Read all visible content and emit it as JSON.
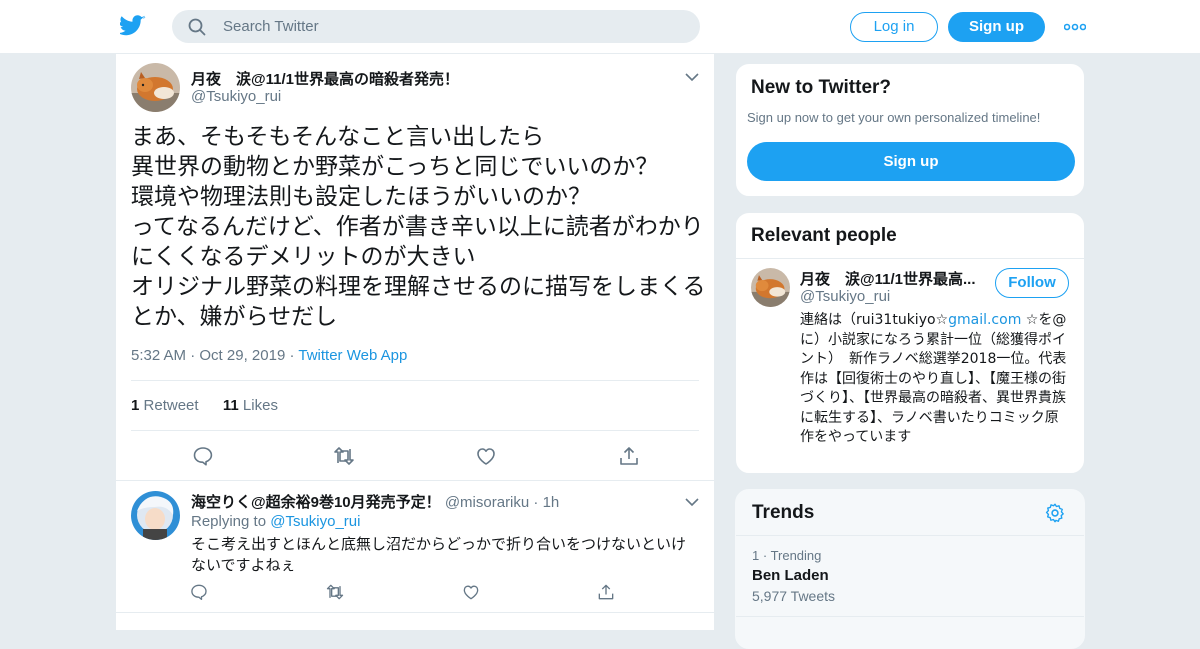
{
  "header": {
    "search_placeholder": "Search Twitter",
    "login_label": "Log in",
    "signup_label": "Sign up"
  },
  "tweet": {
    "author_name": "月夜　涙@11/1世界最高の暗殺者発売！",
    "author_handle": "@Tsukiyo_rui",
    "text": "まあ、そもそもそんなこと言い出したら\n異世界の動物とか野菜がこっちと同じでいいのか？\n環境や物理法則も設定したほうがいいのか？\nってなるんだけど、作者が書き辛い以上に読者がわかりにくくなるデメリットのが大きい\nオリジナル野菜の料理を理解させるのに描写をしまくるとか、嫌がらせだし",
    "time": "5:32 AM",
    "date": "Oct 29, 2019",
    "source": "Twitter Web App",
    "retweet_count": "1",
    "retweet_label": "Retweet",
    "like_count": "11",
    "like_label": "Likes"
  },
  "reply": {
    "author_name": "海空りく@超余裕9巻10月発売予定！",
    "author_handle": "@misorariku",
    "age": "1h",
    "replying_label": "Replying to",
    "replying_to": "@Tsukiyo_rui",
    "text": "そこ考え出すとほんと底無し沼だからどっかで折り合いをつけないといけないですよねぇ"
  },
  "signup_card": {
    "title": "New to Twitter?",
    "subtitle": "Sign up now to get your own personalized timeline!",
    "button": "Sign up"
  },
  "relevant": {
    "title": "Relevant people",
    "name": "月夜　涙@11/1世界最高...",
    "handle": "@Tsukiyo_rui",
    "follow_label": "Follow",
    "bio_prefix": "連絡は（rui31tukiyo☆",
    "bio_link": "gmail.com",
    "bio_rest": " ☆を@に）小説家になろう累計一位（総獲得ポイント）　新作ラノベ総選挙2018一位。代表作は【回復術士のやり直し】、【魔王様の街づくり】、【世界最高の暗殺者、異世界貴族に転生する】、ラノベ書いたりコミック原作をやっています"
  },
  "trends": {
    "title": "Trends",
    "items": [
      {
        "rank": "1",
        "context": "Trending",
        "name": "Ben Laden",
        "count": "5,977 Tweets"
      }
    ]
  },
  "colors": {
    "accent": "#1da1f2",
    "link": "#1b95e0",
    "muted": "#657786",
    "background": "#e6ecf0"
  }
}
